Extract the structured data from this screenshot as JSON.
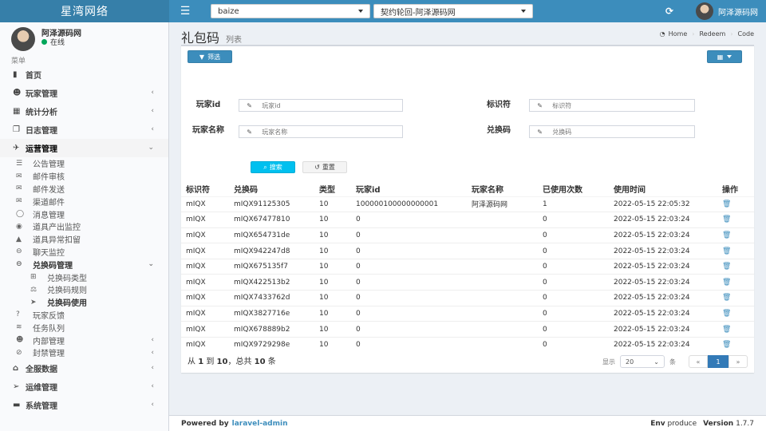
{
  "header": {
    "brand": "星湾网络",
    "select1": "baize",
    "select2": "契约轮回-阿泽源码网",
    "user_name": "阿泽源码网"
  },
  "sidebar": {
    "user_name": "阿泽源码网",
    "status": "在线",
    "menu_label": "菜单",
    "items": [
      {
        "label": "首页"
      },
      {
        "label": "玩家管理"
      },
      {
        "label": "统计分析"
      },
      {
        "label": "日志管理"
      },
      {
        "label": "运营管理"
      },
      {
        "label": "全服数据"
      },
      {
        "label": "运维管理"
      },
      {
        "label": "系统管理"
      }
    ],
    "sub_items": [
      {
        "label": "公告管理"
      },
      {
        "label": "邮件审核"
      },
      {
        "label": "邮件发送"
      },
      {
        "label": "渠道邮件"
      },
      {
        "label": "消息管理"
      },
      {
        "label": "道具产出监控"
      },
      {
        "label": "道具异常扣留"
      },
      {
        "label": "聊天监控"
      },
      {
        "label": "兑换码管理"
      },
      {
        "label": "玩家反馈"
      },
      {
        "label": "任务队列"
      },
      {
        "label": "内部管理"
      },
      {
        "label": "封禁管理"
      }
    ],
    "subsub_items": [
      {
        "label": "兑换码类型"
      },
      {
        "label": "兑换码规则"
      },
      {
        "label": "兑换码使用"
      }
    ]
  },
  "page": {
    "title": "礼包码",
    "subtitle": "列表",
    "breadcrumb": [
      "Home",
      "Redeem",
      "Code"
    ]
  },
  "filter": {
    "button": "筛选",
    "fields": [
      {
        "label": "玩家id",
        "placeholder": "玩家id"
      },
      {
        "label": "标识符",
        "placeholder": "标识符"
      },
      {
        "label": "玩家名称",
        "placeholder": "玩家名称"
      },
      {
        "label": "兑换码",
        "placeholder": "兑换码"
      }
    ],
    "search": "搜索",
    "reset": "重置"
  },
  "table": {
    "headers": [
      "标识符",
      "兑换码",
      "类型",
      "玩家id",
      "玩家名称",
      "已使用次数",
      "使用时间",
      "操作"
    ],
    "rows": [
      [
        "mIQX",
        "mIQX91125305",
        "10",
        "100000100000000001",
        "阿泽源码网",
        "1",
        "2022-05-15 22:05:32"
      ],
      [
        "mIQX",
        "mIQX67477810",
        "10",
        "0",
        "",
        "0",
        "2022-05-15 22:03:24"
      ],
      [
        "mIQX",
        "mIQX654731de",
        "10",
        "0",
        "",
        "0",
        "2022-05-15 22:03:24"
      ],
      [
        "mIQX",
        "mIQX942247d8",
        "10",
        "0",
        "",
        "0",
        "2022-05-15 22:03:24"
      ],
      [
        "mIQX",
        "mIQX675135f7",
        "10",
        "0",
        "",
        "0",
        "2022-05-15 22:03:24"
      ],
      [
        "mIQX",
        "mIQX422513b2",
        "10",
        "0",
        "",
        "0",
        "2022-05-15 22:03:24"
      ],
      [
        "mIQX",
        "mIQX7433762d",
        "10",
        "0",
        "",
        "0",
        "2022-05-15 22:03:24"
      ],
      [
        "mIQX",
        "mIQX3827716e",
        "10",
        "0",
        "",
        "0",
        "2022-05-15 22:03:24"
      ],
      [
        "mIQX",
        "mIQX678889b2",
        "10",
        "0",
        "",
        "0",
        "2022-05-15 22:03:24"
      ],
      [
        "mIQX",
        "mIQX9729298e",
        "10",
        "0",
        "",
        "0",
        "2022-05-15 22:03:24"
      ]
    ]
  },
  "pager": {
    "prefix": "从",
    "from": "1",
    "to_word": "到",
    "to": "10",
    "total_word": "，总共",
    "total": "10",
    "unit": "条",
    "show": "显示",
    "per_page": "20",
    "per_unit": "条",
    "prev": "«",
    "current": "1",
    "next": "»"
  },
  "footer": {
    "powered": "Powered by",
    "link": "laravel-admin",
    "env_label": "Env",
    "env": "produce",
    "version_label": "Version",
    "version": "1.7.7"
  },
  "colors": {
    "primary": "#3c8dbc",
    "info": "#00c0ef",
    "bg": "#ecf0f5"
  }
}
